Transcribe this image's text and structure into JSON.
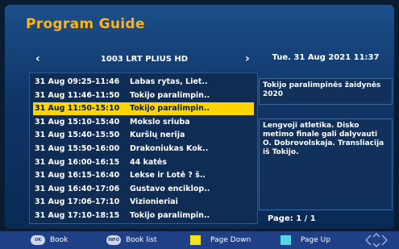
{
  "header": {
    "title": "Program Guide"
  },
  "channel": {
    "prev": "‹",
    "name": "1003  LRT PLIUS HD",
    "next": "›"
  },
  "datetime": "Tue.   31 Aug 2021 11:37",
  "programs": [
    {
      "time": "31 Aug 09:25-11:46",
      "name": "Labas rytas, Liet.."
    },
    {
      "time": "31 Aug 11:46-11:50",
      "name": "Tokijo paralimpin.."
    },
    {
      "time": "31 Aug 11:50-15:10",
      "name": "Tokijo paralimpin..",
      "selected": true
    },
    {
      "time": "31 Aug 15:10-15:40",
      "name": "Mokslo sriuba"
    },
    {
      "time": "31 Aug 15:40-15:50",
      "name": "Kuršlų nerija"
    },
    {
      "time": "31 Aug 15:50-16:00",
      "name": "Drakoniukas Kok.."
    },
    {
      "time": "31 Aug 16:00-16:15",
      "name": "44 katės"
    },
    {
      "time": "31 Aug 16:15-16:40",
      "name": "Lekse ir Lotė ? š.."
    },
    {
      "time": "31 Aug 16:40-17:06",
      "name": "Gustavo enciklop.."
    },
    {
      "time": "31 Aug 17:06-17:10",
      "name": "Vizionieriai"
    },
    {
      "time": "31 Aug 17:10-18:15",
      "name": "Tokijo paralimpin.."
    }
  ],
  "details": {
    "title": "Tokijo paralimpinės žaidynės 2020",
    "description": "Lengvoji atletika. Disko metimo finale gali dalyvauti O. Dobrovolskaja. Transliacija iš Tokijo."
  },
  "page": {
    "label": "Page:  1 / 1"
  },
  "footer": {
    "ok_icon": "OK",
    "book": "Book",
    "info_icon": "INFO",
    "book_list": "Book list",
    "page_down": "Page Down",
    "page_up": "Page Up",
    "yellow_color": "#f6e21e",
    "cyan_color": "#55d5e6"
  }
}
